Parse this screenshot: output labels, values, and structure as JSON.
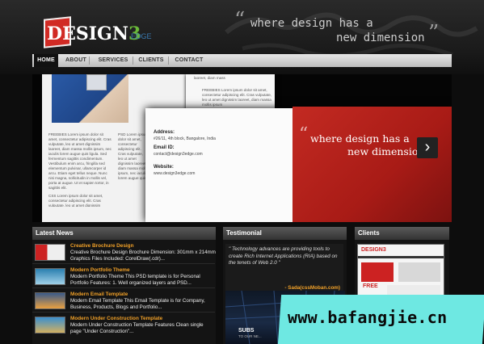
{
  "header": {
    "logo_main": "DESIGN",
    "logo_num": "3",
    "logo_sub": "EDGE",
    "tagline_line1": "where design has a",
    "tagline_line2": "new dimension"
  },
  "nav": {
    "items": [
      {
        "label": "HOME"
      },
      {
        "label": "ABOUT"
      },
      {
        "label": "SERVICES"
      },
      {
        "label": "CLIENTS"
      },
      {
        "label": "CONTACT"
      }
    ],
    "active": "HOME"
  },
  "banner": {
    "col1_a": "FREEBIES Lorem ipsum dolor sit amet, consectetur adipiscing elit. Cras vulputate, leo ut amet dignissim laoreet, diam massa mollis ipsum, nec iaculis lorem augue quis ligula. Sed fermentum sagittis condimentum. Vestibulum enim arcu, fringilla sed elementum pulvinar, ullamcorper id arcu. Etiam eget tellus neque. Nunc nisi magna, sollicitudin in mollis vel, porta at augue. Ut et sapien tortor, in sagittis elit.",
    "col1_b": "CSS Lorem ipsum dolor sit amet, consectetur adipiscing elit. Cras vulputate, leo ut amet dignissim laoreet, diam massa mollis ipsum.",
    "col2": "PSD Lorem ipsum dolor sit amet, consectetur adipiscing elit. Cras vulputate, leo ut amet dignissim laoreet, diam massa mollis ipsum, nec iaculis lorem augue quis ligula. Sed fermentum sagittis condimentum pulvinar.",
    "top_note": "laoreet, diam mass",
    "paper2_text": "FREEBIES Lorem ipsum dolor sit amet, consectetur adipiscing elit. Cras vulputate, leo ut amet dignissim laoreet, diam massa mollis ipsum",
    "address_label": "Address:",
    "address_value": "#26/11, 4th block, Bangalore, India",
    "email_label": "Email ID:",
    "email_value": "contact@design3edge.com",
    "website_label": "Website:",
    "website_value": "www.design3edge.com",
    "red_line1": "where design has a",
    "red_line2": "new dimension",
    "next_glyph": "›"
  },
  "latest_news": {
    "title": "Latest News",
    "items": [
      {
        "title": "Creative Brochure Design",
        "body": "Creative Brochure Design Brochure Dimension: 301mm x 214mm Graphics Files Included: CorelDraw(.cdr)..."
      },
      {
        "title": "Modern Portfolio Theme",
        "body": "Modern Portfolio Theme This PSD template is for Personal Portfolio Features: 1. Well organized layers and PSD..."
      },
      {
        "title": "Modern Email Template",
        "body": "Modern Email Template This Email Template is for Company, Business, Products, Blogs and Portfolio..."
      },
      {
        "title": "Modern Under Construction Template",
        "body": "Modern Under Construction Template Features Clean single page \"Under Construction\"..."
      }
    ]
  },
  "testimonial": {
    "title": "Testimonial",
    "quote": "\" Technology advances are providing tools to create Rich Internet Applications (RIA) based on the tenets of Web 2.0 \"",
    "author": "- Sada(cssMoban.com)",
    "subscribe": "SUBS",
    "subscribe_sub": "TO OUR NE..."
  },
  "clients": {
    "title": "Clients",
    "shot_logo": "DESIGN3",
    "shot_badge": "FREE"
  },
  "watermark": {
    "text": "www.bafangjie.cn"
  },
  "colors": {
    "accent": "#f0a028",
    "brand_red": "#c32a22",
    "watermark": "#6ee8e2"
  }
}
